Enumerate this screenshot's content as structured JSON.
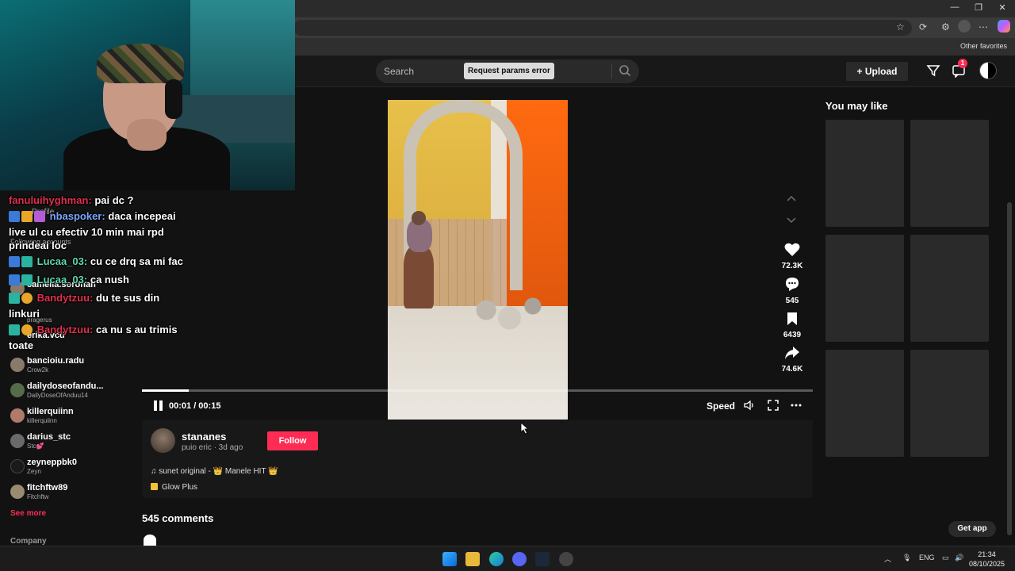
{
  "browser": {
    "favorites_label": "Other favorites"
  },
  "header": {
    "search_placeholder": "Search",
    "tooltip": "Request params error",
    "upload_label": "Upload",
    "inbox_badge": "1"
  },
  "sidebar": {
    "ghost_items": [
      "Profile",
      "Following accounts"
    ],
    "accounts": [
      {
        "name": "camelia.sorohan",
        "sub": ""
      },
      {
        "name": "",
        "sub": "pragerus"
      },
      {
        "name": "erika.vcd",
        "sub": ""
      },
      {
        "name": "bancioiu.radu",
        "sub": "Crow2k"
      },
      {
        "name": "dailydoseofandu...",
        "sub": "DailyDoseOfAnduu14"
      },
      {
        "name": "killerquiinn",
        "sub": "killerquiinn"
      },
      {
        "name": "darius_stc",
        "sub": "Stc💕"
      },
      {
        "name": "zeyneppbk0",
        "sub": "Zeyn"
      },
      {
        "name": "fitchftw89",
        "sub": "Fitchftw"
      }
    ],
    "see_more": "See more",
    "company": "Company"
  },
  "chat": [
    {
      "user": "fanuluihyghman:",
      "color": "#e0304e",
      "text": "pai dc ?"
    },
    {
      "user": "nbaspoker:",
      "color": "#7aa7ff",
      "text": "daca incepeai live ul cu efectiv 10 min mai rpd prindeai loc"
    },
    {
      "user": "Lucaa_03:",
      "color": "#5fd9b0",
      "text": "cu ce drq sa mi fac"
    },
    {
      "user": "Lucaa_03:",
      "color": "#5fd9b0",
      "text": "ca nush"
    },
    {
      "user": "Bandytzuu:",
      "color": "#e0304e",
      "text": "du te sus din linkuri"
    },
    {
      "user": "Bandytzuu:",
      "color": "#e0304e",
      "text": "ca nu s au trimis toate"
    }
  ],
  "player": {
    "time": "00:01 / 00:15",
    "speed_label": "Speed",
    "progress": 0.07
  },
  "actions": {
    "likes": "72.3K",
    "comments": "545",
    "saves": "6439",
    "shares": "74.6K"
  },
  "author": {
    "username": "stananes",
    "subline": "puio eric · 3d ago",
    "follow_label": "Follow",
    "music": "♫ sunet original - 👑 Manele HIT 👑",
    "effect": "Glow Plus"
  },
  "comments_title": "545 comments",
  "right_rail": {
    "title": "You may like",
    "get_app": "Get app"
  },
  "taskbar": {
    "lang": "ENG",
    "time": "21:34",
    "date": "08/10/2025"
  }
}
